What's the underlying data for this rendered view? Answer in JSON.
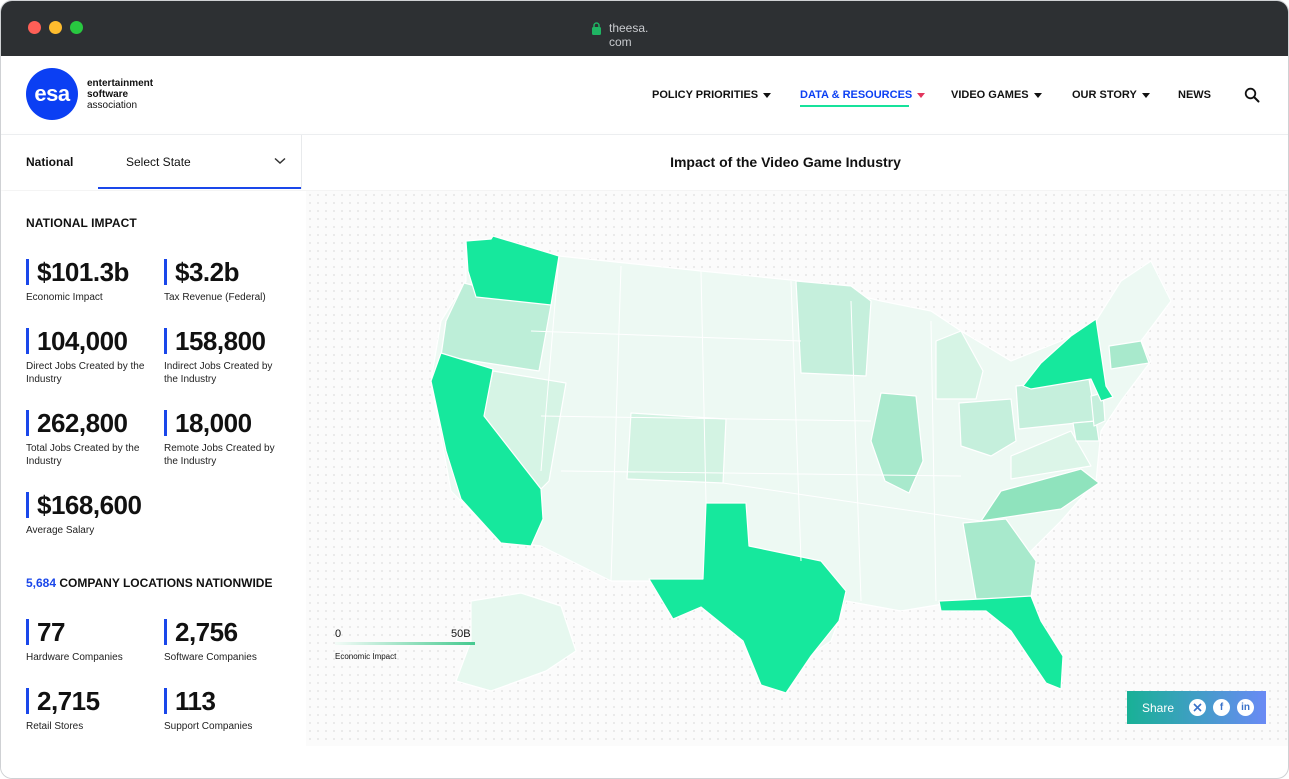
{
  "browser": {
    "url": "theesa.\ncom",
    "url_line1": "theesa.",
    "url_line2": "com"
  },
  "logo": {
    "mark": "esa",
    "line1": "entertainment",
    "line2": "software",
    "line3": "association"
  },
  "nav": {
    "items": [
      {
        "label": "POLICY PRIORITIES",
        "active": false
      },
      {
        "label": "DATA & RESOURCES",
        "active": true
      },
      {
        "label": "VIDEO GAMES",
        "active": false
      },
      {
        "label": "OUR STORY",
        "active": false
      },
      {
        "label": "NEWS",
        "active": false
      }
    ],
    "search_icon": "search-icon"
  },
  "subbar": {
    "national_tab": "National",
    "state_select": "Select State",
    "title": "Impact of the Video Game Industry"
  },
  "national_impact": {
    "title": "NATIONAL IMPACT",
    "stats": [
      {
        "value": "$101.3b",
        "label": "Economic Impact"
      },
      {
        "value": "$3.2b",
        "label": "Tax Revenue (Federal)"
      },
      {
        "value": "104,000",
        "label": "Direct Jobs Created by the Industry"
      },
      {
        "value": "158,800",
        "label": "Indirect Jobs Created by the Industry"
      },
      {
        "value": "262,800",
        "label": "Total Jobs Created by the Industry"
      },
      {
        "value": "18,000",
        "label": "Remote Jobs Created by the Industry"
      },
      {
        "value": "$168,600",
        "label": "Average Salary"
      }
    ]
  },
  "locations": {
    "count": "5,684",
    "title": "COMPANY LOCATIONS NATIONWIDE",
    "stats": [
      {
        "value": "77",
        "label": "Hardware Companies"
      },
      {
        "value": "2,756",
        "label": "Software Companies"
      },
      {
        "value": "2,715",
        "label": "Retail Stores"
      },
      {
        "value": "113",
        "label": "Support Companies"
      }
    ]
  },
  "legend": {
    "min": "0",
    "max": "50B",
    "caption": "Economic Impact"
  },
  "share": {
    "label": "Share",
    "icons": [
      "x-icon",
      "facebook-icon",
      "linkedin-icon"
    ]
  },
  "colors": {
    "brand_blue": "#0b3ff3",
    "accent_green": "#16e29b",
    "map_high": "#16e89d",
    "map_mid": "#8fe6c2",
    "map_low": "#ecf9f2"
  }
}
